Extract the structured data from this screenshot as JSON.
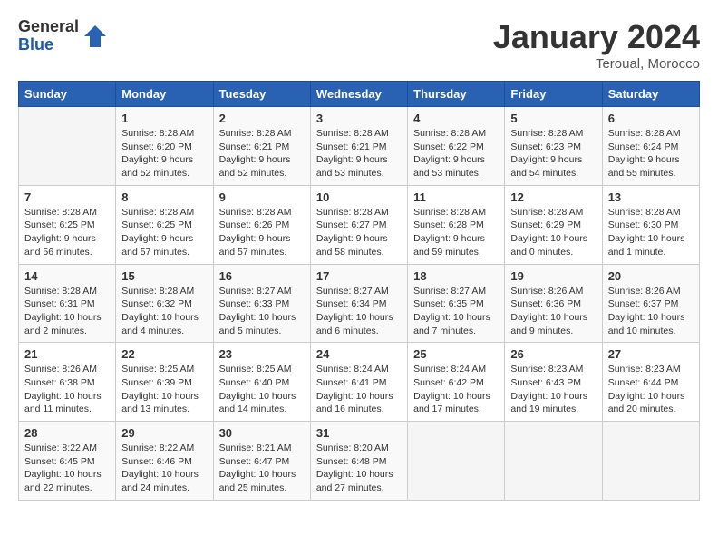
{
  "logo": {
    "general": "General",
    "blue": "Blue"
  },
  "title": "January 2024",
  "location": "Teroual, Morocco",
  "days_of_week": [
    "Sunday",
    "Monday",
    "Tuesday",
    "Wednesday",
    "Thursday",
    "Friday",
    "Saturday"
  ],
  "weeks": [
    [
      {
        "day": "",
        "sunrise": "",
        "sunset": "",
        "daylight": ""
      },
      {
        "day": "1",
        "sunrise": "Sunrise: 8:28 AM",
        "sunset": "Sunset: 6:20 PM",
        "daylight": "Daylight: 9 hours and 52 minutes."
      },
      {
        "day": "2",
        "sunrise": "Sunrise: 8:28 AM",
        "sunset": "Sunset: 6:21 PM",
        "daylight": "Daylight: 9 hours and 52 minutes."
      },
      {
        "day": "3",
        "sunrise": "Sunrise: 8:28 AM",
        "sunset": "Sunset: 6:21 PM",
        "daylight": "Daylight: 9 hours and 53 minutes."
      },
      {
        "day": "4",
        "sunrise": "Sunrise: 8:28 AM",
        "sunset": "Sunset: 6:22 PM",
        "daylight": "Daylight: 9 hours and 53 minutes."
      },
      {
        "day": "5",
        "sunrise": "Sunrise: 8:28 AM",
        "sunset": "Sunset: 6:23 PM",
        "daylight": "Daylight: 9 hours and 54 minutes."
      },
      {
        "day": "6",
        "sunrise": "Sunrise: 8:28 AM",
        "sunset": "Sunset: 6:24 PM",
        "daylight": "Daylight: 9 hours and 55 minutes."
      }
    ],
    [
      {
        "day": "7",
        "sunrise": "Sunrise: 8:28 AM",
        "sunset": "Sunset: 6:25 PM",
        "daylight": "Daylight: 9 hours and 56 minutes."
      },
      {
        "day": "8",
        "sunrise": "Sunrise: 8:28 AM",
        "sunset": "Sunset: 6:25 PM",
        "daylight": "Daylight: 9 hours and 57 minutes."
      },
      {
        "day": "9",
        "sunrise": "Sunrise: 8:28 AM",
        "sunset": "Sunset: 6:26 PM",
        "daylight": "Daylight: 9 hours and 57 minutes."
      },
      {
        "day": "10",
        "sunrise": "Sunrise: 8:28 AM",
        "sunset": "Sunset: 6:27 PM",
        "daylight": "Daylight: 9 hours and 58 minutes."
      },
      {
        "day": "11",
        "sunrise": "Sunrise: 8:28 AM",
        "sunset": "Sunset: 6:28 PM",
        "daylight": "Daylight: 9 hours and 59 minutes."
      },
      {
        "day": "12",
        "sunrise": "Sunrise: 8:28 AM",
        "sunset": "Sunset: 6:29 PM",
        "daylight": "Daylight: 10 hours and 0 minutes."
      },
      {
        "day": "13",
        "sunrise": "Sunrise: 8:28 AM",
        "sunset": "Sunset: 6:30 PM",
        "daylight": "Daylight: 10 hours and 1 minute."
      }
    ],
    [
      {
        "day": "14",
        "sunrise": "Sunrise: 8:28 AM",
        "sunset": "Sunset: 6:31 PM",
        "daylight": "Daylight: 10 hours and 2 minutes."
      },
      {
        "day": "15",
        "sunrise": "Sunrise: 8:28 AM",
        "sunset": "Sunset: 6:32 PM",
        "daylight": "Daylight: 10 hours and 4 minutes."
      },
      {
        "day": "16",
        "sunrise": "Sunrise: 8:27 AM",
        "sunset": "Sunset: 6:33 PM",
        "daylight": "Daylight: 10 hours and 5 minutes."
      },
      {
        "day": "17",
        "sunrise": "Sunrise: 8:27 AM",
        "sunset": "Sunset: 6:34 PM",
        "daylight": "Daylight: 10 hours and 6 minutes."
      },
      {
        "day": "18",
        "sunrise": "Sunrise: 8:27 AM",
        "sunset": "Sunset: 6:35 PM",
        "daylight": "Daylight: 10 hours and 7 minutes."
      },
      {
        "day": "19",
        "sunrise": "Sunrise: 8:26 AM",
        "sunset": "Sunset: 6:36 PM",
        "daylight": "Daylight: 10 hours and 9 minutes."
      },
      {
        "day": "20",
        "sunrise": "Sunrise: 8:26 AM",
        "sunset": "Sunset: 6:37 PM",
        "daylight": "Daylight: 10 hours and 10 minutes."
      }
    ],
    [
      {
        "day": "21",
        "sunrise": "Sunrise: 8:26 AM",
        "sunset": "Sunset: 6:38 PM",
        "daylight": "Daylight: 10 hours and 11 minutes."
      },
      {
        "day": "22",
        "sunrise": "Sunrise: 8:25 AM",
        "sunset": "Sunset: 6:39 PM",
        "daylight": "Daylight: 10 hours and 13 minutes."
      },
      {
        "day": "23",
        "sunrise": "Sunrise: 8:25 AM",
        "sunset": "Sunset: 6:40 PM",
        "daylight": "Daylight: 10 hours and 14 minutes."
      },
      {
        "day": "24",
        "sunrise": "Sunrise: 8:24 AM",
        "sunset": "Sunset: 6:41 PM",
        "daylight": "Daylight: 10 hours and 16 minutes."
      },
      {
        "day": "25",
        "sunrise": "Sunrise: 8:24 AM",
        "sunset": "Sunset: 6:42 PM",
        "daylight": "Daylight: 10 hours and 17 minutes."
      },
      {
        "day": "26",
        "sunrise": "Sunrise: 8:23 AM",
        "sunset": "Sunset: 6:43 PM",
        "daylight": "Daylight: 10 hours and 19 minutes."
      },
      {
        "day": "27",
        "sunrise": "Sunrise: 8:23 AM",
        "sunset": "Sunset: 6:44 PM",
        "daylight": "Daylight: 10 hours and 20 minutes."
      }
    ],
    [
      {
        "day": "28",
        "sunrise": "Sunrise: 8:22 AM",
        "sunset": "Sunset: 6:45 PM",
        "daylight": "Daylight: 10 hours and 22 minutes."
      },
      {
        "day": "29",
        "sunrise": "Sunrise: 8:22 AM",
        "sunset": "Sunset: 6:46 PM",
        "daylight": "Daylight: 10 hours and 24 minutes."
      },
      {
        "day": "30",
        "sunrise": "Sunrise: 8:21 AM",
        "sunset": "Sunset: 6:47 PM",
        "daylight": "Daylight: 10 hours and 25 minutes."
      },
      {
        "day": "31",
        "sunrise": "Sunrise: 8:20 AM",
        "sunset": "Sunset: 6:48 PM",
        "daylight": "Daylight: 10 hours and 27 minutes."
      },
      {
        "day": "",
        "sunrise": "",
        "sunset": "",
        "daylight": ""
      },
      {
        "day": "",
        "sunrise": "",
        "sunset": "",
        "daylight": ""
      },
      {
        "day": "",
        "sunrise": "",
        "sunset": "",
        "daylight": ""
      }
    ]
  ]
}
